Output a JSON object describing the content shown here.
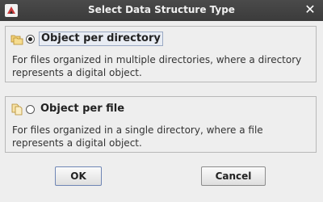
{
  "window": {
    "title": "Select Data Structure Type",
    "close_glyph": "✕"
  },
  "options": [
    {
      "icon": "folders-icon",
      "label": "Object per directory",
      "selected": true,
      "description": "For files organized in multiple directories, where a directory represents a digital object."
    },
    {
      "icon": "files-icon",
      "label": "Object per file",
      "selected": false,
      "description": "For files organized in a single directory, where a file represents a digital object."
    }
  ],
  "buttons": {
    "ok_label": "OK",
    "cancel_label": "Cancel"
  },
  "colors": {
    "titlebar": "#3b3b3b",
    "background": "#eeeeee",
    "focus_border": "#9aa9c3"
  }
}
